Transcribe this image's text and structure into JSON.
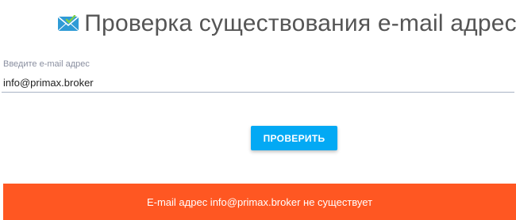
{
  "header": {
    "icon": "envelope-check-icon",
    "title": "Проверка существования e-mail адреса"
  },
  "form": {
    "email_label": "Введите e-mail адрес",
    "email_value": "info@primax.broker",
    "email_placeholder": "",
    "submit_label": "ПРОВЕРИТЬ"
  },
  "result": {
    "message": "E-mail адрес info@primax.broker не существует",
    "status": "not-exists"
  },
  "colors": {
    "accent": "#03a9f4",
    "error": "#ff5722",
    "icon": "#2f9bd6",
    "icon_check": "#7fd14a"
  }
}
